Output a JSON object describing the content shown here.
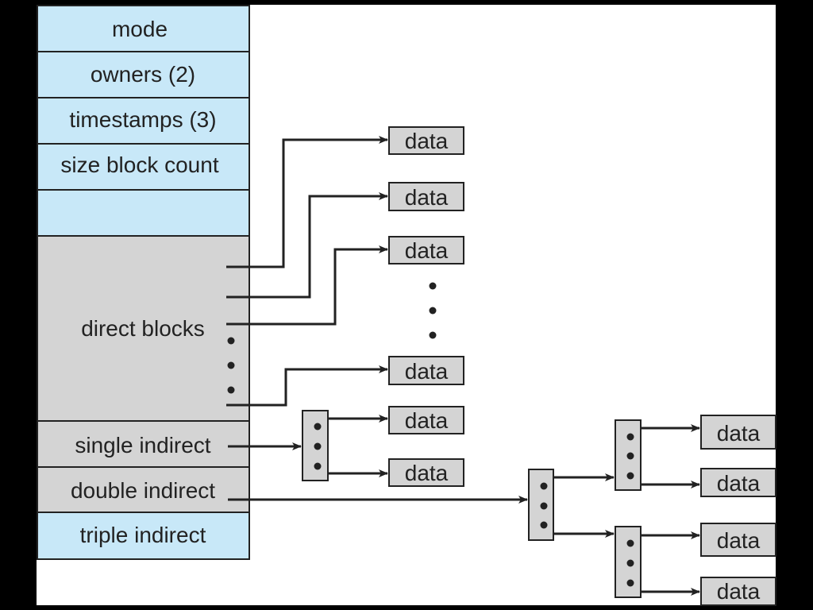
{
  "colors": {
    "field_blue": "#c8e8f8",
    "field_gray": "#d4d4d4",
    "line": "#222222",
    "background": "#ffffff"
  },
  "inode": {
    "fields": [
      "mode",
      "owners (2)",
      "timestamps (3)",
      "size block count",
      ""
    ],
    "direct_blocks": "direct blocks",
    "single_indirect": "single indirect",
    "double_indirect": "double indirect",
    "triple_indirect": "triple indirect"
  },
  "data_label": "data"
}
